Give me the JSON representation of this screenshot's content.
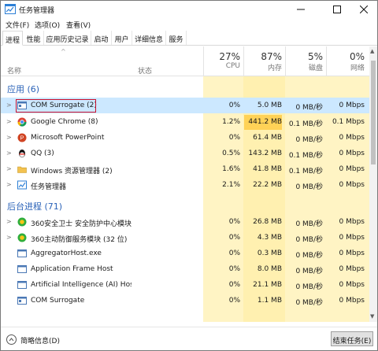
{
  "window": {
    "title": "任务管理器",
    "accent": "#2a62b8",
    "highlight": "#cce8ff",
    "cpu_color": "#fff4c4",
    "mem_color": "#ffe8a0"
  },
  "menu": [
    "文件(F)",
    "选项(O)",
    "查看(V)"
  ],
  "tabs": [
    "进程",
    "性能",
    "应用历史记录",
    "启动",
    "用户",
    "详细信息",
    "服务"
  ],
  "header": {
    "name": "名称",
    "status": "状态",
    "cpu_pct": "27%",
    "cpu": "CPU",
    "mem_pct": "87%",
    "mem": "内存",
    "disk_pct": "5%",
    "disk": "磁盘",
    "net_pct": "0%",
    "net": "网络"
  },
  "groups": {
    "apps": "应用 (6)",
    "background": "后台进程 (71)"
  },
  "apps": [
    {
      "name": "COM Surrogate (2)",
      "icon": "com-surrogate-icon",
      "cpu": "0%",
      "mem": "5.0 MB",
      "disk": "0 MB/秒",
      "net": "0 Mbps"
    },
    {
      "name": "Google Chrome (8)",
      "icon": "chrome-icon",
      "cpu": "1.2%",
      "mem": "441.2 MB",
      "disk": "0.1 MB/秒",
      "net": "0.1 Mbps"
    },
    {
      "name": "Microsoft PowerPoint",
      "icon": "powerpoint-icon",
      "cpu": "0%",
      "mem": "61.4 MB",
      "disk": "0 MB/秒",
      "net": "0 Mbps"
    },
    {
      "name": "QQ (3)",
      "icon": "qq-icon",
      "cpu": "0.5%",
      "mem": "143.2 MB",
      "disk": "0.1 MB/秒",
      "net": "0 Mbps"
    },
    {
      "name": "Windows 资源管理器 (2)",
      "icon": "explorer-icon",
      "cpu": "1.6%",
      "mem": "41.8 MB",
      "disk": "0.1 MB/秒",
      "net": "0 Mbps"
    },
    {
      "name": "任务管理器",
      "icon": "task-manager-icon",
      "cpu": "2.1%",
      "mem": "22.2 MB",
      "disk": "0 MB/秒",
      "net": "0 Mbps"
    }
  ],
  "background": [
    {
      "name": "360安全卫士 安全防护中心模块 ...",
      "icon": "360-shield-icon",
      "cpu": "0%",
      "mem": "26.8 MB",
      "disk": "0 MB/秒",
      "net": "0 Mbps"
    },
    {
      "name": "360主动防御服务模块 (32 位)",
      "icon": "360-defense-icon",
      "cpu": "0%",
      "mem": "4.3 MB",
      "disk": "0 MB/秒",
      "net": "0 Mbps"
    },
    {
      "name": "AggregatorHost.exe",
      "icon": "exe-icon",
      "cpu": "0%",
      "mem": "0.3 MB",
      "disk": "0 MB/秒",
      "net": "0 Mbps"
    },
    {
      "name": "Application Frame Host",
      "icon": "exe-icon",
      "cpu": "0%",
      "mem": "8.0 MB",
      "disk": "0 MB/秒",
      "net": "0 Mbps"
    },
    {
      "name": "Artificial Intelligence (AI) Host f...",
      "icon": "exe-icon",
      "cpu": "0%",
      "mem": "21.1 MB",
      "disk": "0 MB/秒",
      "net": "0 Mbps"
    },
    {
      "name": "COM Surrogate",
      "icon": "com-surrogate-icon",
      "cpu": "0%",
      "mem": "1.1 MB",
      "disk": "0 MB/秒",
      "net": "0 Mbps"
    }
  ],
  "footer": {
    "fewer": "简略信息(D)",
    "end_task": "结束任务(E)"
  }
}
